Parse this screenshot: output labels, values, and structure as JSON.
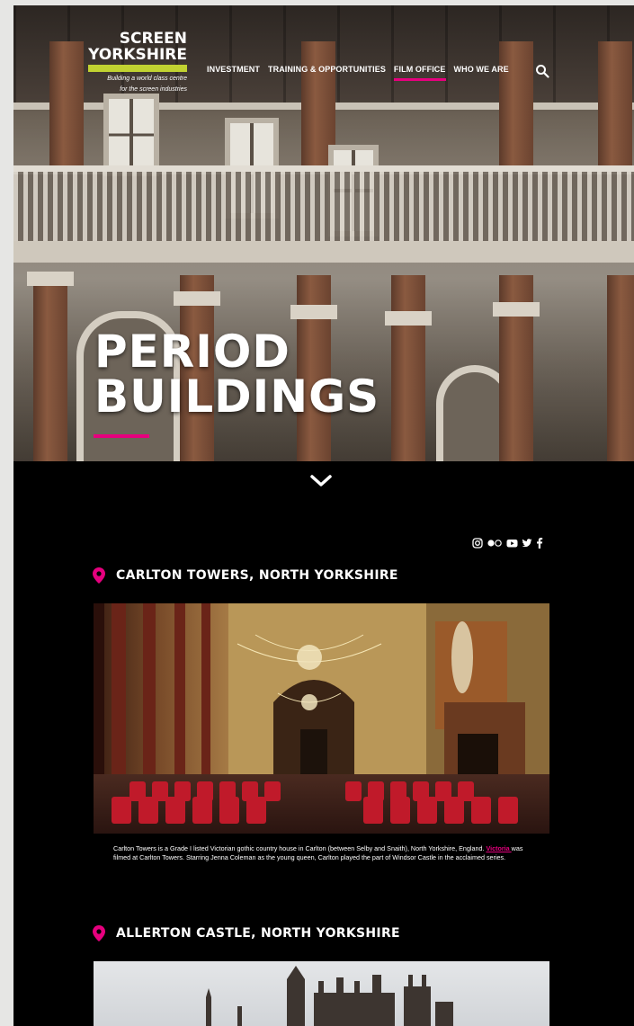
{
  "brand": {
    "line1": "SCREEN",
    "line2": "YORKSHIRE",
    "tagline1": "Building a world class centre",
    "tagline2": "for the screen industries",
    "accent": "#c1d231"
  },
  "nav": {
    "items": [
      {
        "label": "INVESTMENT",
        "active": false
      },
      {
        "label": "TRAINING & OPPORTUNITIES",
        "active": false
      },
      {
        "label": "FILM OFFICE",
        "active": true
      },
      {
        "label": "WHO WE ARE",
        "active": false
      }
    ],
    "search_icon": "search-icon",
    "active_color": "#e6007e"
  },
  "hero": {
    "title_line1": "PERIOD",
    "title_line2": "BUILDINGS"
  },
  "scroll_icon": "chevron-down-icon",
  "social": [
    "instagram-icon",
    "flickr-icon",
    "youtube-icon",
    "twitter-icon",
    "facebook-icon"
  ],
  "locations": [
    {
      "title": "CARLTON TOWERS, NORTH YORKSHIRE",
      "caption_before": "Carlton Towers is a Grade I listed Victorian gothic country house in Carlton (between Selby and Snaith), North Yorkshire, England. ",
      "caption_link": "Victoria ",
      "caption_after": "was filmed at Carlton Towers. Starring Jenna Coleman as the young queen, Carlton played the part of Windsor Castle in the acclaimed series."
    },
    {
      "title": "ALLERTON CASTLE, NORTH YORKSHIRE"
    }
  ]
}
